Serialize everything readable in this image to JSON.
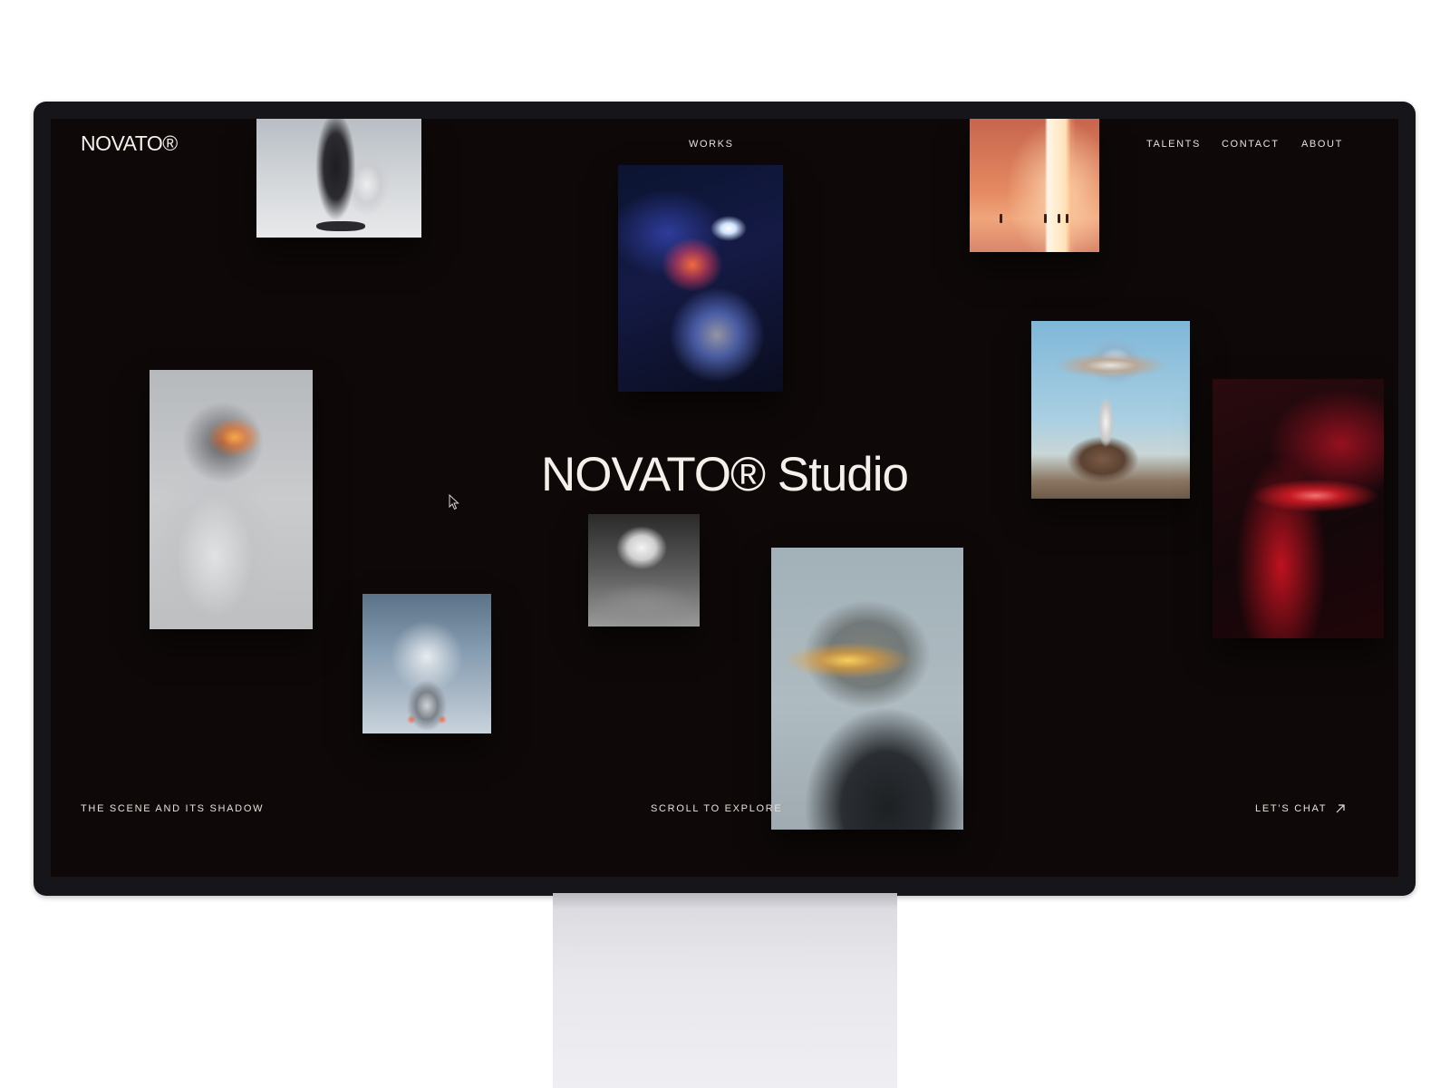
{
  "header": {
    "logo": "NOVATO®",
    "nav_center": "WORKS",
    "nav_right": [
      "TALENTS",
      "CONTACT",
      "ABOUT"
    ]
  },
  "hero": {
    "title": "NOVATO® Studio"
  },
  "footer": {
    "left": "THE SCENE AND ITS SHADOW",
    "center": "SCROLL TO EXPLORE",
    "right": "LET’S CHAT"
  },
  "icons": {
    "chat": "arrow-up-right-icon",
    "pointer": "mouse-cursor-icon"
  },
  "colors": {
    "screen_bg": "#0e0908",
    "text": "#f4f0ea",
    "bezel": "#15151a"
  }
}
